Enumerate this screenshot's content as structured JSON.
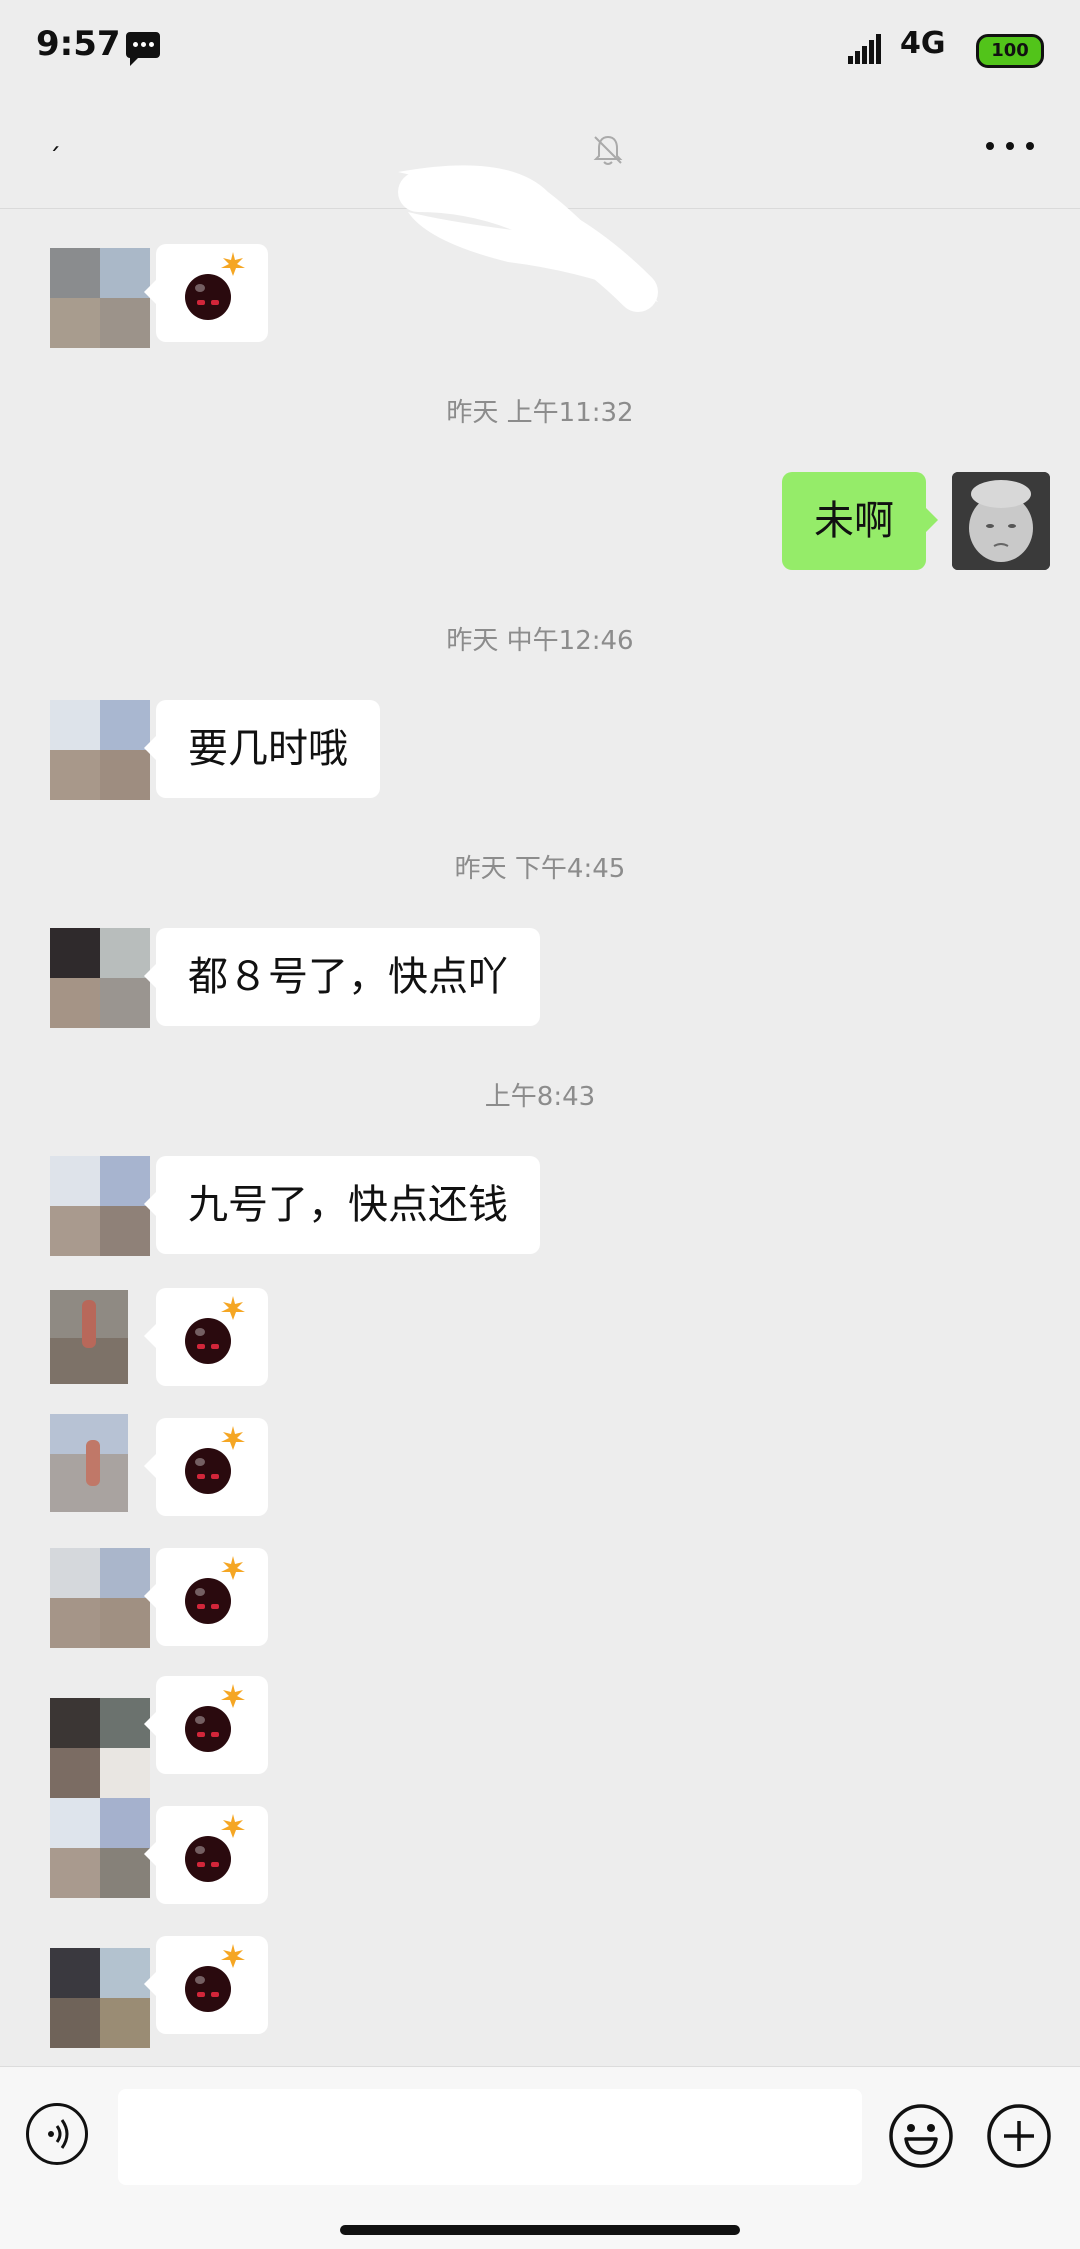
{
  "status_bar": {
    "time": "9:57",
    "network": "4G",
    "battery": "100",
    "icons": [
      "message-notification-icon",
      "signal-icon",
      "battery-icon"
    ]
  },
  "nav_bar": {
    "title_obscured": true,
    "icons": [
      "back-icon",
      "mute-bell-icon",
      "more-icon"
    ]
  },
  "timestamps": {
    "t1": "昨天 上午11:32",
    "t2": "昨天 中午12:46",
    "t3": "昨天 下午4:45",
    "t4": "上午8:43"
  },
  "messages": {
    "m0": {
      "type": "emoji",
      "emoji": "bomb"
    },
    "m1": {
      "type": "text",
      "from": "me",
      "text": "未啊"
    },
    "m2": {
      "type": "text",
      "from": "other",
      "text": "要几时哦"
    },
    "m3": {
      "type": "text",
      "from": "other",
      "text": "都８号了，快点吖"
    },
    "m4": {
      "type": "text",
      "from": "other",
      "text": "九号了，快点还钱"
    },
    "m5": {
      "type": "emoji",
      "emoji": "bomb"
    },
    "m6": {
      "type": "emoji",
      "emoji": "bomb"
    },
    "m7": {
      "type": "emoji",
      "emoji": "bomb"
    },
    "m8": {
      "type": "emoji",
      "emoji": "bomb"
    },
    "m9": {
      "type": "emoji",
      "emoji": "bomb"
    },
    "m10": {
      "type": "emoji",
      "emoji": "bomb"
    }
  },
  "input_bar": {
    "value": "",
    "icons": [
      "voice-icon",
      "emoji-icon",
      "plus-icon"
    ]
  },
  "colors": {
    "background": "#ededed",
    "my_bubble": "#95ec69",
    "other_bubble": "#ffffff",
    "timestamp": "#8c8c8c",
    "battery_fill": "#52c41a"
  }
}
